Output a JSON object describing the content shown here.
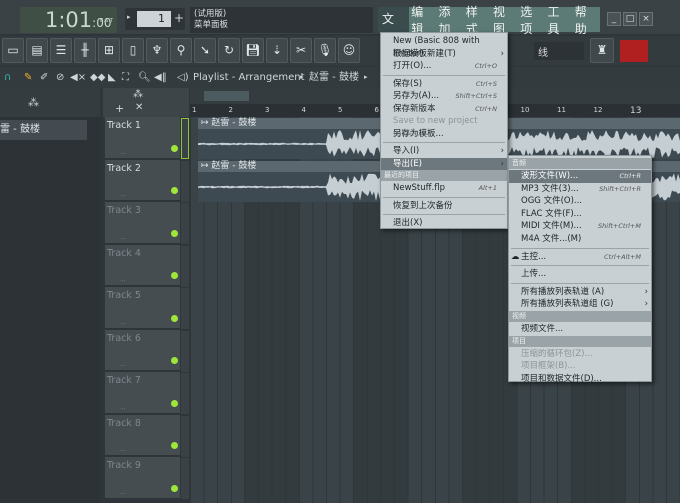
{
  "transport": {
    "time": "1:01",
    "time_small": ":00",
    "time_mode": "B:S:T",
    "pattern": "1",
    "pattern_add": "+"
  },
  "hint": {
    "line1": "(试用版)",
    "line2": "菜单面板"
  },
  "menubar": {
    "items": [
      "文件",
      "编辑",
      "添加",
      "样式",
      "视图",
      "选项",
      "工具",
      "帮助"
    ],
    "active": "文件"
  },
  "window_buttons": [
    "_",
    "□",
    "×"
  ],
  "toolbar": {
    "snap_value": "线"
  },
  "playlist": {
    "title": "Playlist - Arrangement",
    "pattern": "赵雷 - 鼓楼"
  },
  "browser": {
    "item": "雷 - 鼓楼"
  },
  "ruler": [
    "1",
    "2",
    "3",
    "4",
    "5",
    "6",
    "7",
    "8",
    "9",
    "10",
    "11",
    "12",
    "13"
  ],
  "tracks": [
    "Track 1",
    "Track 2",
    "Track 3",
    "Track 4",
    "Track 5",
    "Track 6",
    "Track 7",
    "Track 8",
    "Track 9"
  ],
  "clips": [
    {
      "track": 1,
      "name": "赵雷 - 鼓楼"
    },
    {
      "track": 2,
      "name": "赵雷 - 鼓楼"
    }
  ],
  "file_menu": {
    "items": [
      {
        "label": "New (Basic 808 with limiter)"
      },
      {
        "label": "根据模板新建(T)",
        "submenu": true
      },
      {
        "label": "打开(O)...",
        "key": "Ctrl+O"
      },
      {
        "sep": true
      },
      {
        "label": "保存(S)",
        "key": "Ctrl+S"
      },
      {
        "label": "另存为(A)...",
        "key": "Shift+Ctrl+S"
      },
      {
        "label": "保存新版本",
        "key": "Ctrl+N"
      },
      {
        "label": "Save to new project folder...",
        "disabled": true
      },
      {
        "label": "另存为模板..."
      },
      {
        "sep": true
      },
      {
        "label": "导入(I)",
        "submenu": true
      },
      {
        "label": "导出(E)",
        "submenu": true,
        "highlighted": true
      },
      {
        "header": "最近的项目"
      },
      {
        "label": "NewStuff.flp",
        "key": "Alt+1"
      },
      {
        "sep": true
      },
      {
        "label": "恢复到上次备份"
      },
      {
        "sep": true
      },
      {
        "label": "退出(X)"
      }
    ]
  },
  "export_menu": {
    "items": [
      {
        "header": "音频"
      },
      {
        "label": "波形文件(W)...",
        "key": "Ctrl+R",
        "highlighted": true
      },
      {
        "label": "MP3 文件(3)...",
        "key": "Shift+Ctrl+R"
      },
      {
        "label": "OGG 文件(O)..."
      },
      {
        "label": "FLAC 文件(F)..."
      },
      {
        "label": "MIDI 文件(M)...",
        "key": "Shift+Ctrl+M"
      },
      {
        "label": "M4A 文件...(M)"
      },
      {
        "sep": true
      },
      {
        "label": "主控...",
        "key": "Ctrl+Alt+M",
        "icon": "cloud-icon"
      },
      {
        "sep": true
      },
      {
        "label": "上传..."
      },
      {
        "sep": true
      },
      {
        "label": "所有播放列表轨道 (A)",
        "submenu": true
      },
      {
        "label": "所有播放列表轨道组 (G)",
        "submenu": true
      },
      {
        "header": "视频"
      },
      {
        "label": "视频文件..."
      },
      {
        "header": "项目"
      },
      {
        "label": "压缩的循环包(Z)...",
        "disabled": true
      },
      {
        "label": "项目框架(B)...",
        "disabled": true
      },
      {
        "label": "项目和数据文件(D)..."
      }
    ]
  },
  "colors": {
    "accent_green": "#9ee63a",
    "menubar": "#5c7a76",
    "menu_bg": "#c8d0d3"
  }
}
